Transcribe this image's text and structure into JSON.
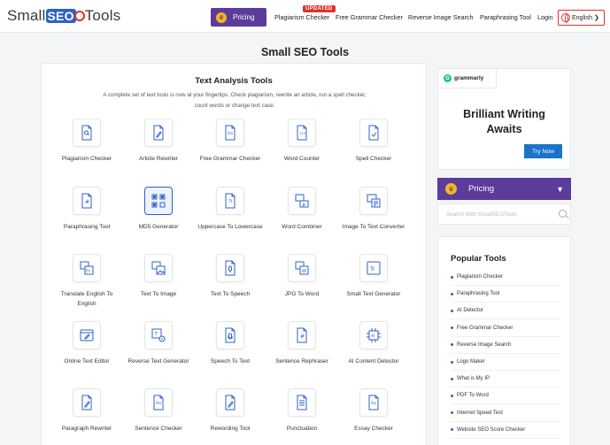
{
  "header": {
    "logo": {
      "prefix": "Small",
      "seo": "SEO",
      "suffix": "Tools"
    },
    "pricing_label": "Pricing",
    "updated_badge": "UPDATED",
    "nav": [
      "Plagiarism Checker",
      "Free Grammar Checker",
      "Reverse Image Search",
      "Paraphrasing Tool",
      "Login"
    ],
    "language": "English"
  },
  "page_title": "Small SEO Tools",
  "main": {
    "title": "Text Analysis Tools",
    "description_line1": "A complete set of text tools is now at your fingertips. Check plagiarism, rewrite an article, run a spell checker,",
    "description_line2": "count words or change text case.",
    "tools": [
      {
        "label": "Plagiarism Checker",
        "icon": "search-doc-icon"
      },
      {
        "label": "Article Rewriter",
        "icon": "pen-doc-icon"
      },
      {
        "label": "Free Grammar Checker",
        "icon": "aa-doc-icon"
      },
      {
        "label": "Word Counter",
        "icon": "123-doc-icon"
      },
      {
        "label": "Spell Checker",
        "icon": "check-doc-icon"
      },
      {
        "label": "Paraphrasing Tool",
        "icon": "hash-doc-icon"
      },
      {
        "label": "MD5 Generator",
        "icon": "qr-icon"
      },
      {
        "label": "Uppercase To Lowercase",
        "icon": "case-doc-icon"
      },
      {
        "label": "Word Combiner",
        "icon": "combine-icon"
      },
      {
        "label": "Image To Text Converter",
        "icon": "image-text-icon"
      },
      {
        "label": "Translate English To English",
        "icon": "translate-icon"
      },
      {
        "label": "Text To Image",
        "icon": "text-image-icon"
      },
      {
        "label": "Text To Speech",
        "icon": "speech-doc-icon"
      },
      {
        "label": "JPG To Word",
        "icon": "jpg-word-icon"
      },
      {
        "label": "Small Text Generator",
        "icon": "tt-icon"
      },
      {
        "label": "Online Text Editor",
        "icon": "editor-icon"
      },
      {
        "label": "Reverse Text Generator",
        "icon": "reverse-icon"
      },
      {
        "label": "Speech To Text",
        "icon": "mic-doc-icon"
      },
      {
        "label": "Sentence Rephraser",
        "icon": "hash-doc-icon"
      },
      {
        "label": "AI Content Detector",
        "icon": "ai-chip-icon"
      },
      {
        "label": "Paragraph Rewriter",
        "icon": "pen-doc-icon"
      },
      {
        "label": "Sentence Checker",
        "icon": "aa-doc-icon"
      },
      {
        "label": "Rewording Tool",
        "icon": "pen-doc-icon"
      },
      {
        "label": "Punctuation",
        "icon": "lines-doc-icon"
      },
      {
        "label": "Essay Checker",
        "icon": "aa-doc-icon"
      }
    ]
  },
  "sidebar": {
    "ad_brand": "grammarly",
    "ad_headline_1": "Brilliant Writing",
    "ad_headline_2": "Awaits",
    "ad_button": "Try Now",
    "pricing_label": "Pricing",
    "search_placeholder": "Search With SmallSEOTools",
    "popular_title": "Popular Tools",
    "popular": [
      "Plagiarism Checker",
      "Paraphrasing Tool",
      "AI Detector",
      "Free Grammar Checker",
      "Reverse Image Search",
      "Logo Maker",
      "What is My IP",
      "PDF To Word",
      "Internet Speed Test",
      "Website SEO Score Checker"
    ]
  },
  "colors": {
    "accent": "#5b3c9b",
    "brand_blue": "#2d62c8",
    "red": "#e0312b",
    "cta": "#1a73c9"
  }
}
